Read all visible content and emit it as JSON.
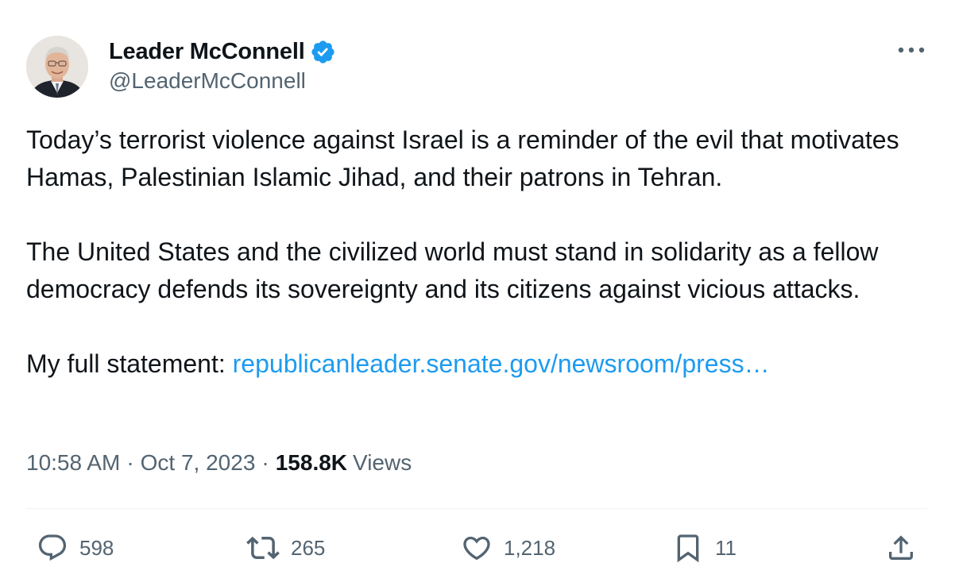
{
  "author": {
    "display_name": "Leader McConnell",
    "handle": "@LeaderMcConnell",
    "verified": true,
    "verified_color": "#1d9bf0"
  },
  "tweet": {
    "paragraphs": [
      "Today’s terrorist violence against Israel is a reminder of the evil that motivates Hamas, Palestinian Islamic Jihad, and their patrons in Tehran.",
      "The United States and the civilized world must stand in solidarity as a fellow democracy defends its sovereignty and its citizens against vicious attacks."
    ],
    "statement_prefix": "My full statement:",
    "link_text": "republicanleader.senate.gov/newsroom/press…",
    "link_color": "#1d9bf0"
  },
  "meta": {
    "time": "10:58 AM",
    "separator": "·",
    "date": "Oct 7, 2023",
    "views_count": "158.8K",
    "views_label": "Views"
  },
  "actions": {
    "replies": "598",
    "reposts": "265",
    "likes": "1,218",
    "bookmarks": "11"
  },
  "icons": {
    "more": "more-horizontal-icon",
    "reply": "reply-icon",
    "repost": "repost-icon",
    "like": "heart-icon",
    "bookmark": "bookmark-icon",
    "share": "share-icon",
    "verified": "verified-badge-icon"
  },
  "colors": {
    "text_primary": "#0f1419",
    "text_secondary": "#536471",
    "divider": "#eff3f4"
  }
}
